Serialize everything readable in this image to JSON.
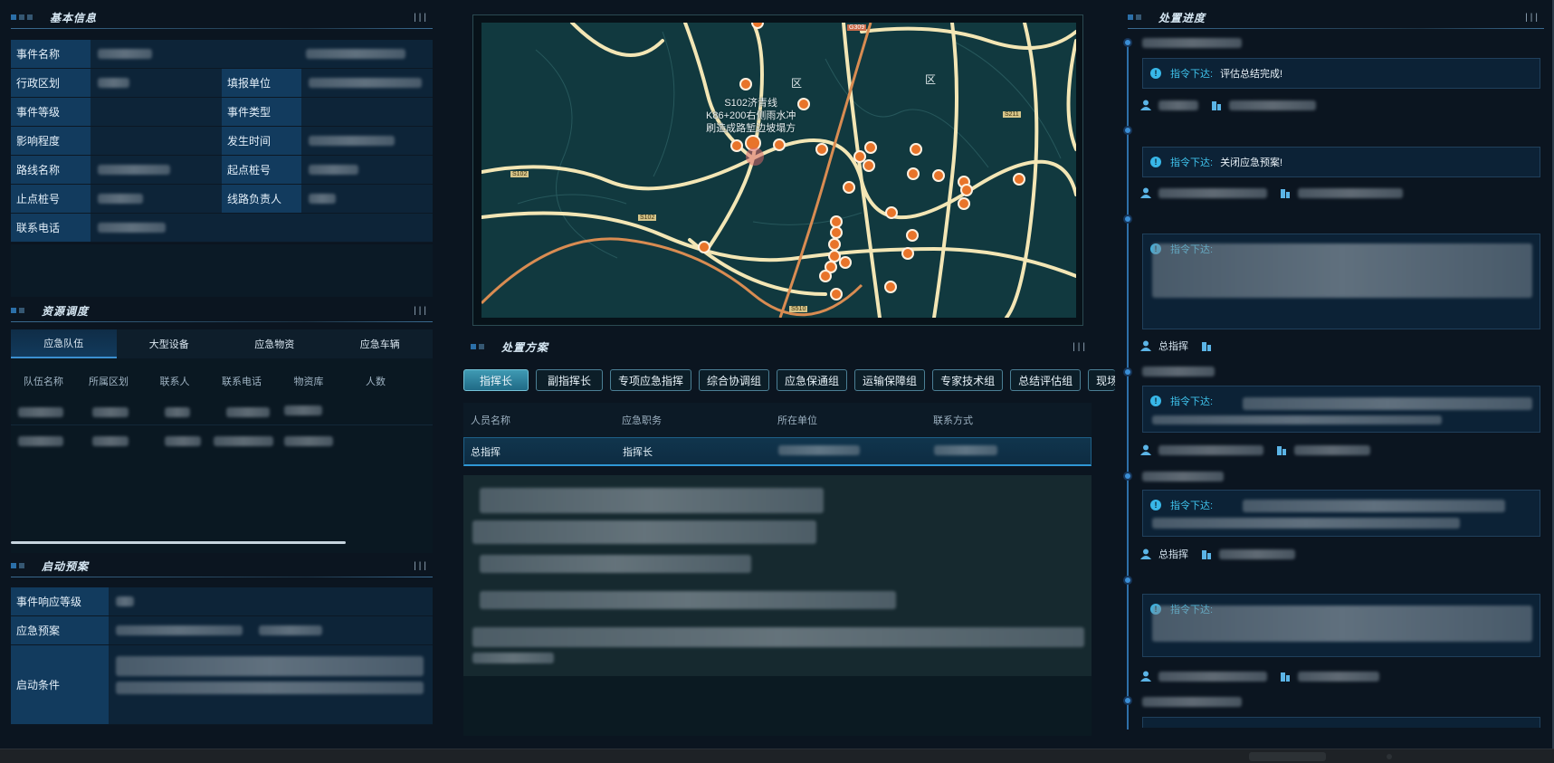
{
  "basic_info": {
    "title": "基本信息",
    "rows": [
      {
        "label": "事件名称",
        "value": ""
      },
      {
        "label": "行政区划",
        "value": "",
        "label2": "填报单位",
        "value2": ""
      },
      {
        "label": "事件等级",
        "value": "",
        "label2": "事件类型",
        "value2": ""
      },
      {
        "label": "影响程度",
        "value": "",
        "label2": "发生时间",
        "value2": ""
      },
      {
        "label": "路线名称",
        "value": "",
        "label2": "起点桩号",
        "value2": ""
      },
      {
        "label": "止点桩号",
        "value": "",
        "label2": "线路负责人",
        "value2": ""
      },
      {
        "label": "联系电话",
        "value": ""
      }
    ]
  },
  "resources": {
    "title": "资源调度",
    "tabs": [
      "应急队伍",
      "大型设备",
      "应急物资",
      "应急车辆"
    ],
    "active_tab": "应急队伍",
    "columns": [
      "队伍名称",
      "所属区划",
      "联系人",
      "联系电话",
      "物资库",
      "人数"
    ]
  },
  "plan_start": {
    "title": "启动预案",
    "rows": [
      {
        "label": "事件响应等级",
        "value": ""
      },
      {
        "label": "应急预案",
        "value": ""
      },
      {
        "label": "启动条件",
        "value": ""
      }
    ]
  },
  "map": {
    "labels": {
      "district1": "区",
      "district2": "区",
      "incident": "S102济青线\nK86+200右侧雨水冲\n刷造成路堑边坡塌方"
    },
    "road_badges": [
      "S102",
      "S102",
      "S510",
      "G309",
      "S211"
    ]
  },
  "plan": {
    "title": "处置方案",
    "groups": [
      "指挥长",
      "副指挥长",
      "专项应急指挥",
      "综合协调组",
      "应急保通组",
      "运输保障组",
      "专家技术组",
      "总结评估组",
      "现场"
    ],
    "active_group": "指挥长",
    "columns": [
      "人员名称",
      "应急职务",
      "所在单位",
      "联系方式"
    ],
    "row": {
      "name": "总指挥",
      "duty": "指挥长",
      "unit": "",
      "phone": ""
    }
  },
  "progress": {
    "title": "处置进度",
    "cmd_label": "指令下达:",
    "items": [
      {
        "text": "评估总结完成!",
        "person": "",
        "org": ""
      },
      {
        "text": "关闭应急预案!",
        "person": "",
        "org": ""
      },
      {
        "text": "",
        "person": "总指挥",
        "org": ""
      },
      {
        "text": "",
        "person": "",
        "org": ""
      },
      {
        "text": "",
        "person": "总指挥",
        "org": ""
      },
      {
        "text": "",
        "person": "",
        "org": ""
      }
    ]
  },
  "colors": {
    "accent": "#3fc3ec",
    "label_bg": "#123b5e",
    "marker": "#e8742a"
  }
}
